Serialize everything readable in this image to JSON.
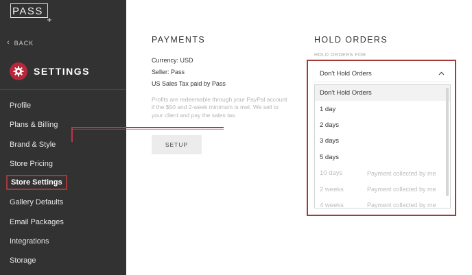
{
  "sidebar": {
    "logo": "PASS",
    "back_label": "BACK",
    "settings_title": "SETTINGS",
    "items": [
      {
        "label": "Profile"
      },
      {
        "label": "Plans & Billing"
      },
      {
        "label": "Brand & Style"
      },
      {
        "label": "Store Pricing"
      },
      {
        "label": "Store Settings",
        "active": true
      },
      {
        "label": "Gallery Defaults"
      },
      {
        "label": "Email Packages"
      },
      {
        "label": "Integrations"
      },
      {
        "label": "Storage"
      }
    ]
  },
  "payments": {
    "title": "PAYMENTS",
    "currency": "Currency: USD",
    "seller": "Seller: Pass",
    "tax": "US Sales Tax paid by Pass",
    "note": "Profits are redeemable through your PayPal account if the $50 and 2-week minimum is met. We sell to your client and pay the sales tax.",
    "setup_label": "SETUP"
  },
  "hold_orders": {
    "title": "HOLD ORDERS",
    "label": "HOLD ORDERS FOR",
    "selected": "Don't Hold Orders",
    "options": [
      {
        "label": "Don't Hold Orders",
        "note": "",
        "disabled": false
      },
      {
        "label": "1 day",
        "note": "",
        "disabled": false
      },
      {
        "label": "2 days",
        "note": "",
        "disabled": false
      },
      {
        "label": "3 days",
        "note": "",
        "disabled": false
      },
      {
        "label": "5 days",
        "note": "",
        "disabled": false
      },
      {
        "label": "10 days",
        "note": "Payment collected by me",
        "disabled": true
      },
      {
        "label": "2 weeks",
        "note": "Payment collected by me",
        "disabled": true
      },
      {
        "label": "4 weeks",
        "note": "Payment collected by me",
        "disabled": true
      }
    ]
  },
  "colors": {
    "sidebar_bg": "#323232",
    "accent": "#b8283a",
    "highlight_border": "#a33a3a"
  }
}
